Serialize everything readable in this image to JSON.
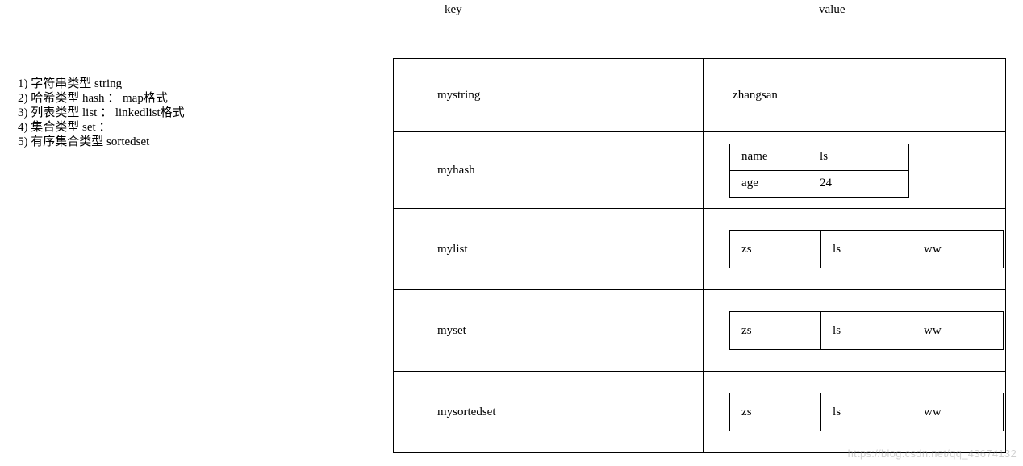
{
  "header": {
    "key_label": "key",
    "value_label": "value"
  },
  "type_list": {
    "items": [
      "1) 字符串类型 string",
      "2) 哈希类型 hash ：  map格式",
      "3) 列表类型 list ：  linkedlist格式",
      "4) 集合类型 set  ：",
      "5) 有序集合类型 sortedset"
    ]
  },
  "rows": {
    "string": {
      "key": "mystring",
      "value": "zhangsan"
    },
    "hash": {
      "key": "myhash",
      "pairs": [
        {
          "k": "name",
          "v": "ls"
        },
        {
          "k": "age",
          "v": "24"
        }
      ]
    },
    "list": {
      "key": "mylist",
      "items": [
        "zs",
        "ls",
        "ww"
      ]
    },
    "set": {
      "key": "myset",
      "items": [
        "zs",
        "ls",
        "ww"
      ]
    },
    "sortedset": {
      "key": "mysortedset",
      "items": [
        "zs",
        "ls",
        "ww"
      ]
    }
  },
  "watermark": "https://blog.csdn.net/qq_43674132"
}
